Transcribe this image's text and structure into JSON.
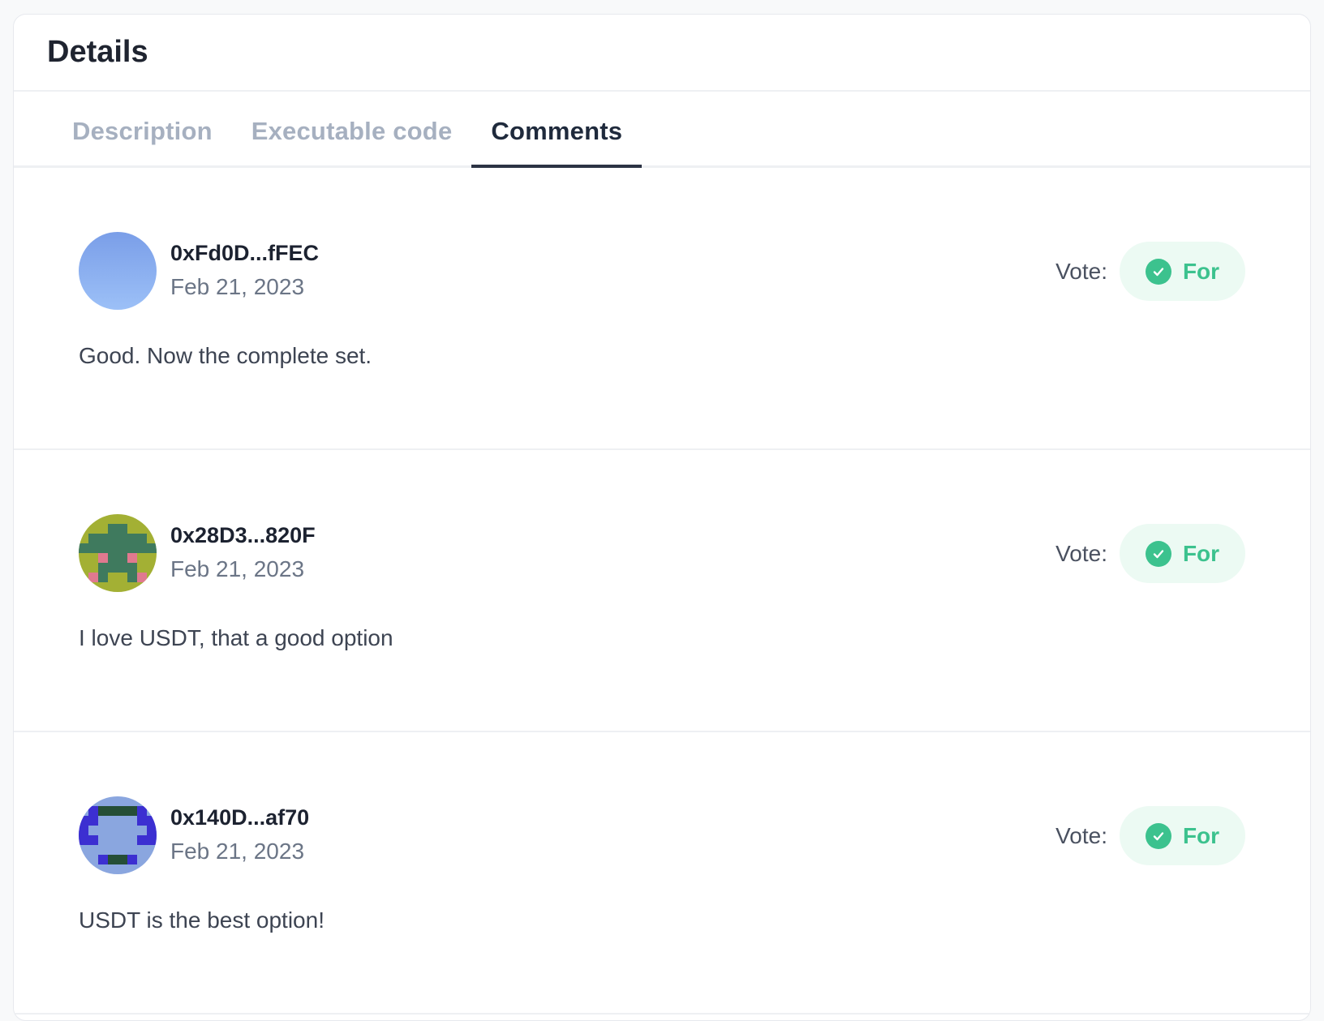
{
  "details": {
    "title": "Details",
    "tabs": [
      {
        "label": "Description",
        "active": false
      },
      {
        "label": "Executable code",
        "active": false
      },
      {
        "label": "Comments",
        "active": true
      }
    ]
  },
  "vote_label": "Vote:",
  "colors": {
    "accent_green": "#3cc28e",
    "pill_bg": "#ecfaf3",
    "active_tab": "#1f2a3c",
    "inactive_tab": "#a6b0c0"
  },
  "comments": [
    {
      "author": "0xFd0D...fFEC",
      "date": "Feb 21, 2023",
      "vote": "For",
      "text": "Good. Now the complete set.",
      "avatar_icon": "gradient-avatar-icon"
    },
    {
      "author": "0x28D3...820F",
      "date": "Feb 21, 2023",
      "vote": "For",
      "text": "I love USDT, that a good option",
      "avatar_icon": "pixel-avatar-icon"
    },
    {
      "author": "0x140D...af70",
      "date": "Feb 21, 2023",
      "vote": "For",
      "text": "USDT is the best option!",
      "avatar_icon": "pixel-avatar-icon"
    }
  ]
}
